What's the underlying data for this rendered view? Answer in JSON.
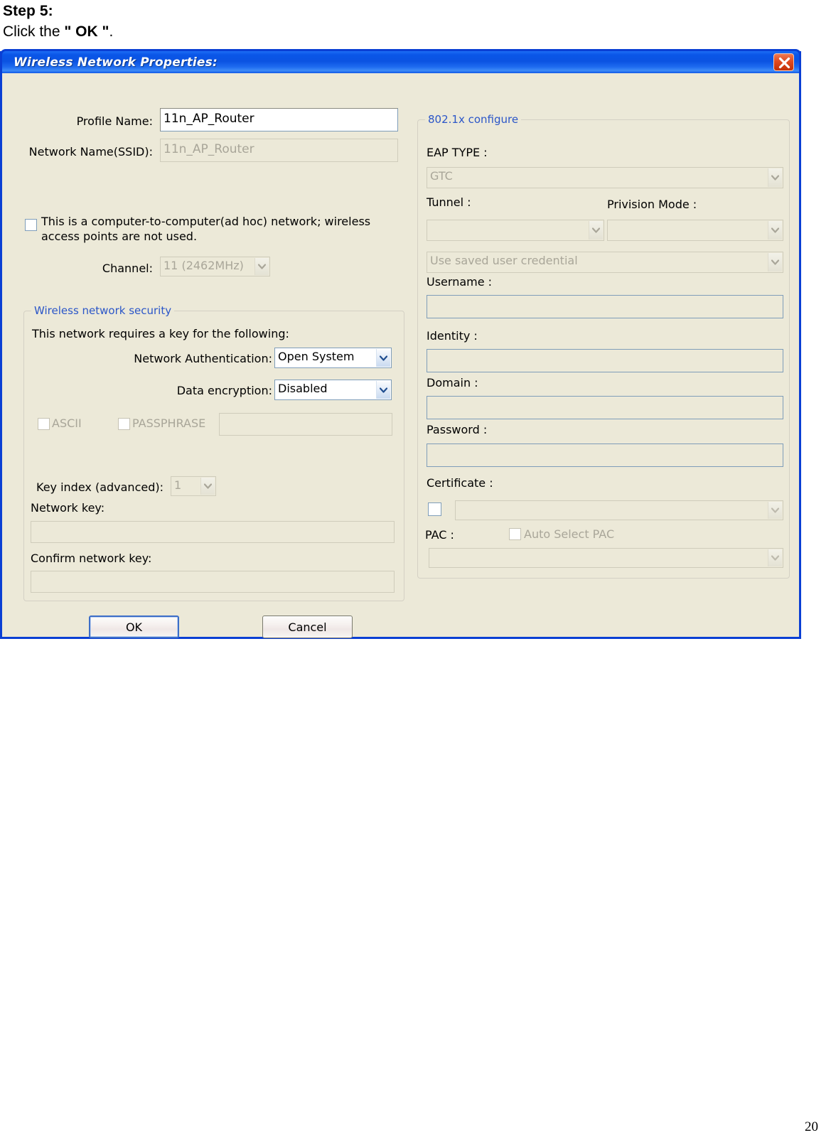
{
  "doc": {
    "step_heading": "Step 5:",
    "step_instruction_prefix": "Click the ",
    "step_instruction_quoted": "\" OK \"",
    "step_instruction_suffix": ".",
    "page_number": "20"
  },
  "dialog": {
    "title": "Wireless Network Properties:",
    "close_icon": "close-icon"
  },
  "left_panel": {
    "profile_name_label": "Profile Name:",
    "profile_name_value": "11n_AP_Router",
    "ssid_label": "Network Name(SSID):",
    "ssid_value": "11n_AP_Router",
    "adhoc_checkbox_label_line1": "This is a computer-to-computer(ad hoc) network; wireless",
    "adhoc_checkbox_label_line2": "access points are not used.",
    "adhoc_checked": false,
    "channel_label": "Channel:",
    "channel_value": "11 (2462MHz)",
    "security_group_title": "Wireless network security",
    "security_intro": "This network requires a key for the following:",
    "network_auth_label": "Network Authentication:",
    "network_auth_value": "Open System",
    "data_encryption_label": "Data encryption:",
    "data_encryption_value": "Disabled",
    "ascii_label": "ASCII",
    "ascii_checked": false,
    "passphrase_label": "PASSPHRASE",
    "passphrase_checked": false,
    "passphrase_value": "",
    "key_index_label": "Key index (advanced):",
    "key_index_value": "1",
    "network_key_label": "Network key:",
    "network_key_value": "",
    "confirm_network_key_label": "Confirm network key:",
    "confirm_network_key_value": ""
  },
  "right_panel": {
    "group_title": "802.1x configure",
    "eap_type_label": "EAP TYPE :",
    "eap_type_value": "GTC",
    "tunnel_label": "Tunnel :",
    "tunnel_value": "",
    "privision_mode_label": "Privision Mode :",
    "privision_mode_value": "",
    "credential_value": "Use saved user credential",
    "username_label": "Username :",
    "username_value": "",
    "identity_label": "Identity :",
    "identity_value": "",
    "domain_label": "Domain :",
    "domain_value": "",
    "password_label": "Password :",
    "password_value": "",
    "certificate_label": "Certificate :",
    "certificate_checked": false,
    "certificate_value": "",
    "pac_label": "PAC :",
    "auto_select_pac_label": "Auto Select PAC",
    "auto_select_pac_checked": false,
    "pac_value": ""
  },
  "buttons": {
    "ok_label": "OK",
    "cancel_label": "Cancel"
  },
  "colors": {
    "title_bar_blue": "#0b53e2",
    "dialog_face": "#ece9d8",
    "group_title_blue": "#2b56c8",
    "close_red": "#c23008",
    "focus_blue": "#3c6ec8"
  }
}
